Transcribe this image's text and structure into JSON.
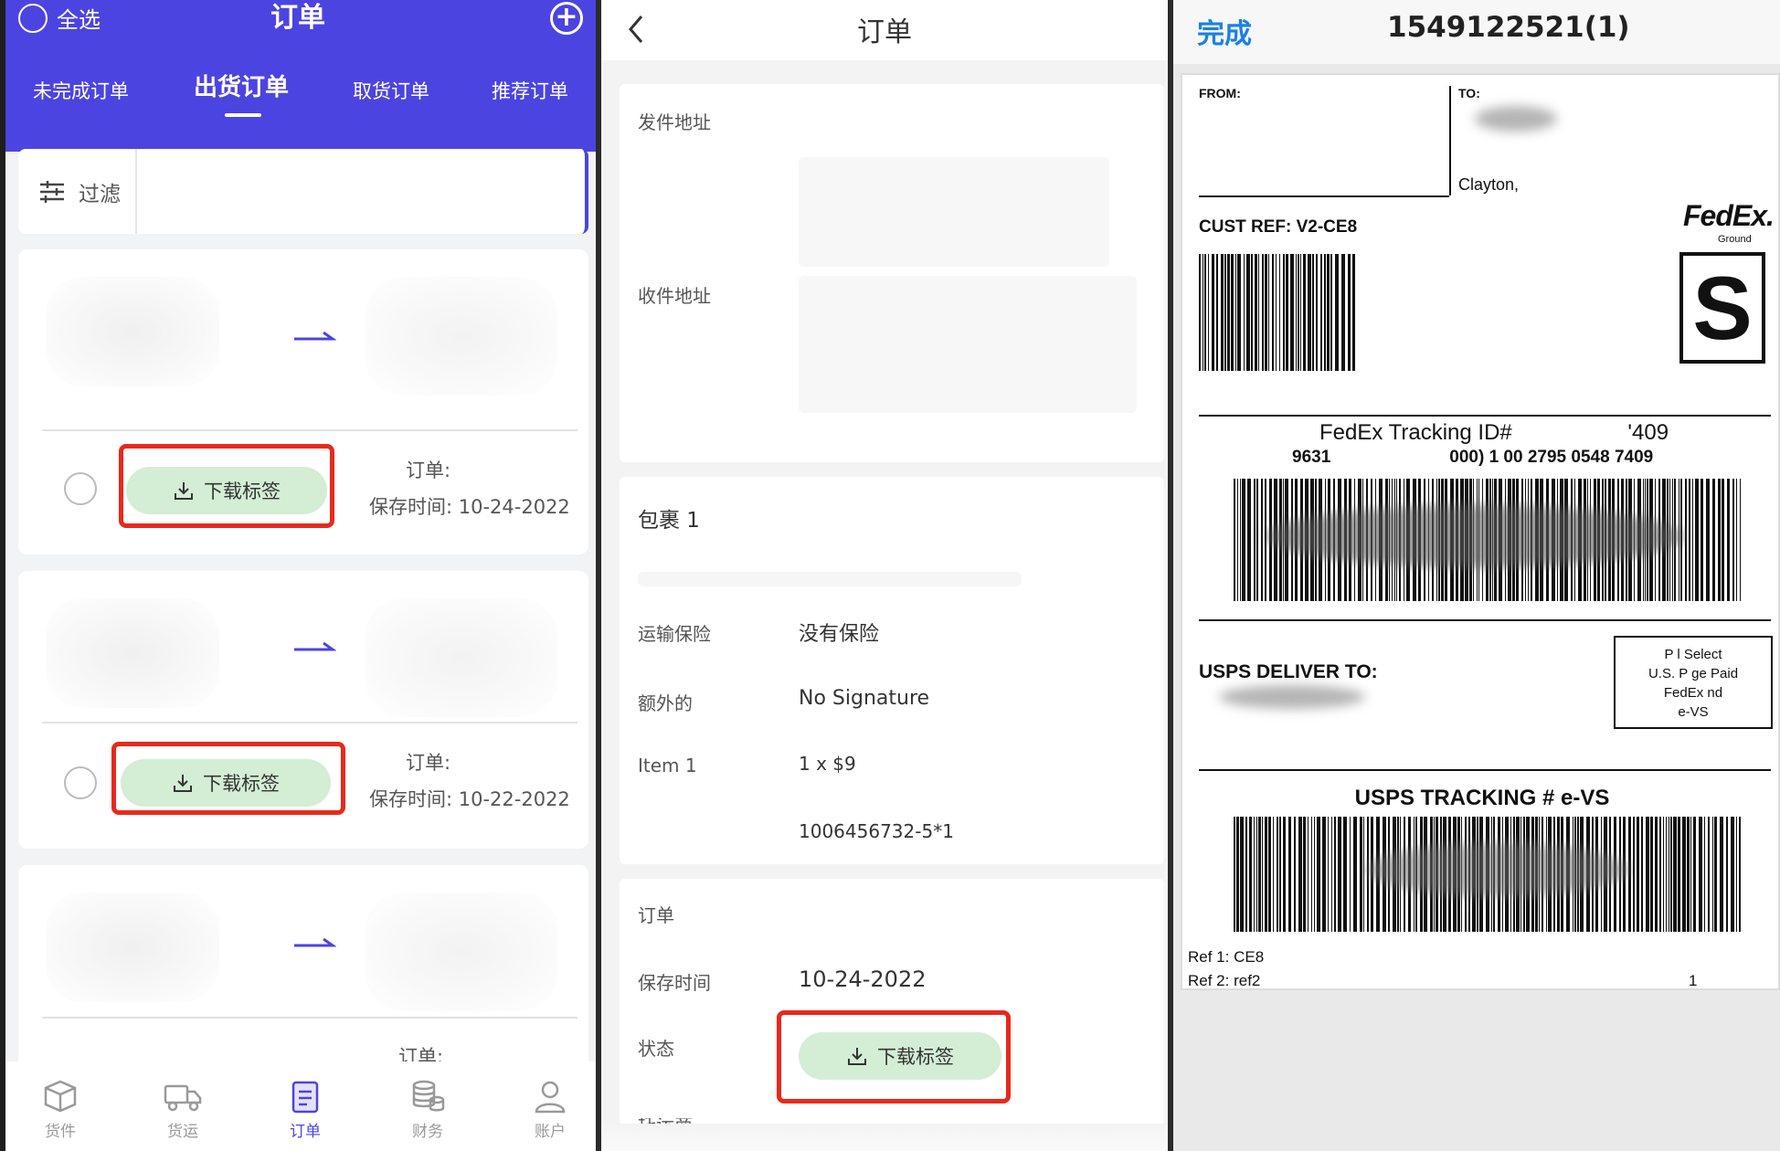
{
  "panel1": {
    "select_all": "全选",
    "title": "订单",
    "tabs": [
      "未完成订单",
      "出货订单",
      "取货订单",
      "推荐订单"
    ],
    "filter_label": "过滤",
    "cards": [
      {
        "download_label": "下载标签",
        "order_label": "订单:",
        "saved_time": "保存时间: 10-24-2022"
      },
      {
        "download_label": "下载标签",
        "order_label": "订单:",
        "saved_time": "保存时间: 10-22-2022"
      },
      {
        "order_label": "订单:"
      }
    ],
    "nav": [
      {
        "label": "货件",
        "icon": "package-icon"
      },
      {
        "label": "货运",
        "icon": "truck-icon"
      },
      {
        "label": "订单",
        "icon": "clipboard-icon"
      },
      {
        "label": "财务",
        "icon": "coins-icon"
      },
      {
        "label": "账户",
        "icon": "user-icon"
      }
    ],
    "accent": "#4c44e0",
    "highlight": "#e8291c"
  },
  "panel2": {
    "title": "订单",
    "sender_label": "发件地址",
    "recipient_label": "收件地址",
    "package_title": "包裹 1",
    "rows": [
      {
        "label": "运输保险",
        "value": "没有保险"
      },
      {
        "label": "额外的",
        "value": "No Signature"
      },
      {
        "label": "Item 1",
        "value": "1 x $9"
      }
    ],
    "sku": "1006456732-5*1",
    "order_label": "订单",
    "saved_label": "保存时间",
    "saved_value": "10-24-2022",
    "status_label": "状态",
    "download_label": "下载标签",
    "cutoff_label": "托运商"
  },
  "panel3": {
    "done": "完成",
    "filename": "1549122521(1)",
    "from": "FROM:",
    "to": "TO:",
    "city": "Clayton,",
    "cust_ref": "CUST REF: V2-CE8",
    "brand": "FedEx.",
    "brand_sub": "Ground",
    "service_letter": "S",
    "tracking_id": "FedEx Tracking ID#",
    "tracking_id_tail": "'409",
    "tracking_line": "9631",
    "tracking_line_tail": "000) 1 00 2795 0548 7409",
    "usps_deliver": "USPS DELIVER TO:",
    "parcel_box": [
      "P  l Select",
      "U.S. P    ge Paid",
      "FedEx    nd",
      "e-VS"
    ],
    "usps_tracking": "USPS TRACKING # e-VS",
    "ref1": "Ref 1: CE8",
    "ref2": "Ref 2: ref2",
    "page_num": "1"
  }
}
